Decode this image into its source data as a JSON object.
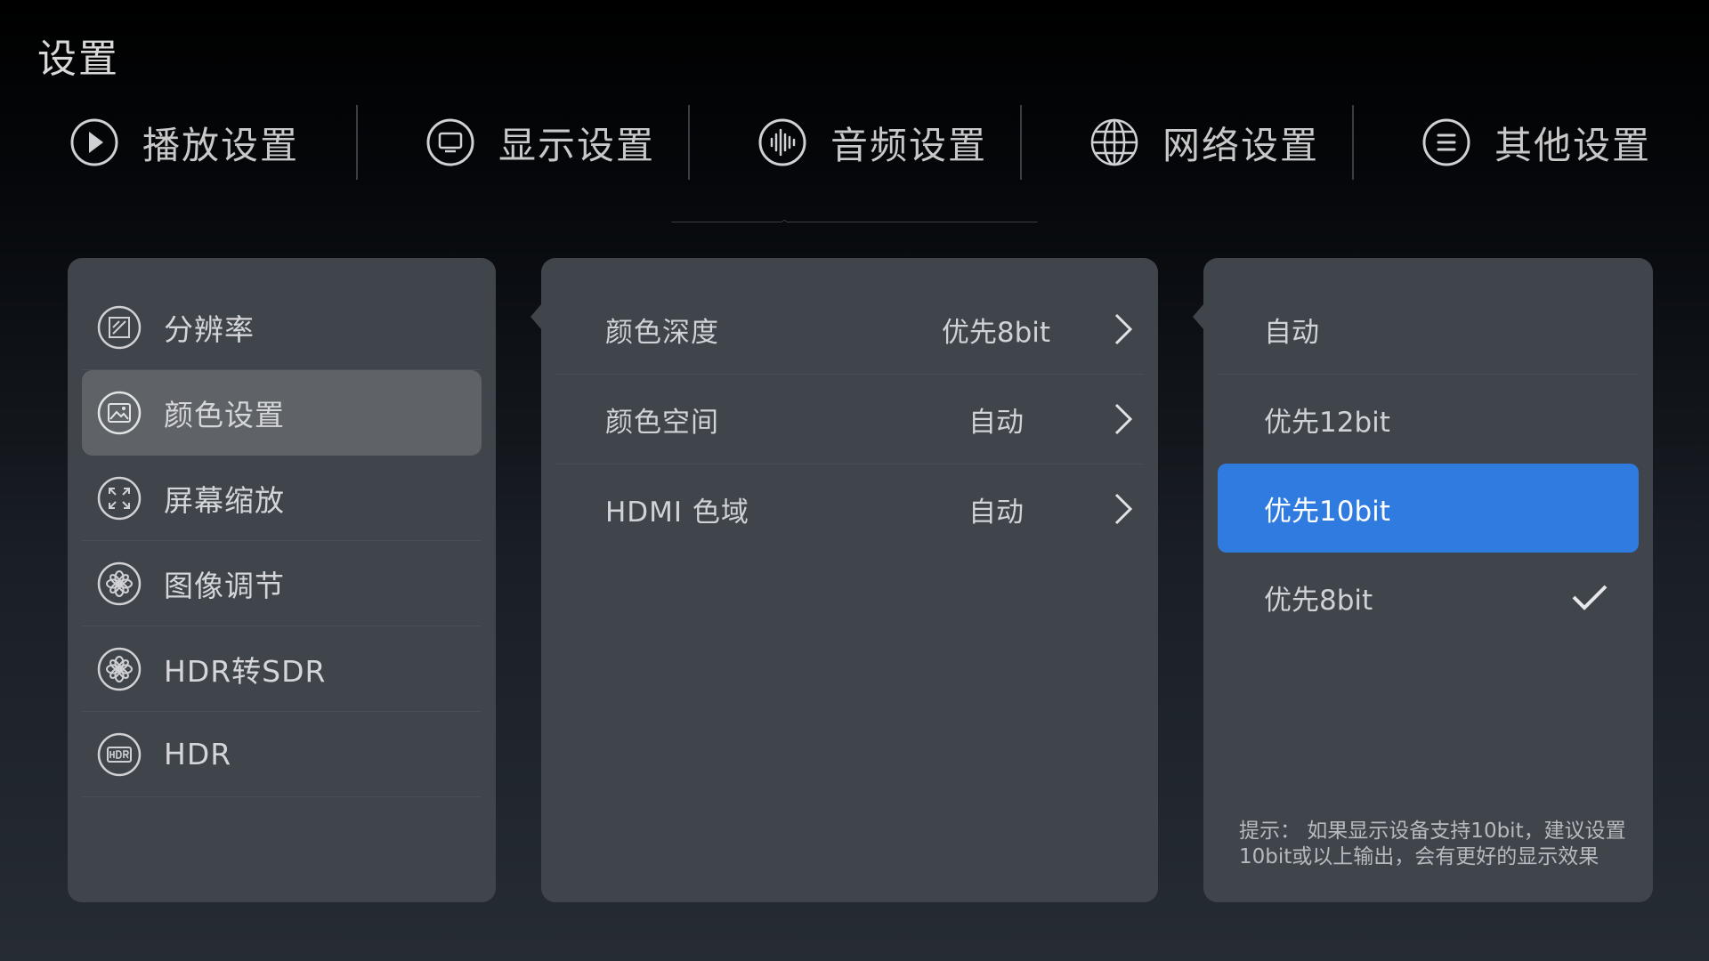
{
  "header": {
    "title": "设置"
  },
  "tabs": [
    {
      "label": "播放设置",
      "icon": "play-circle-icon"
    },
    {
      "label": "显示设置",
      "icon": "monitor-icon"
    },
    {
      "label": "音频设置",
      "icon": "audio-wave-icon"
    },
    {
      "label": "网络设置",
      "icon": "globe-icon"
    },
    {
      "label": "其他设置",
      "icon": "menu-icon"
    }
  ],
  "active_tab": "显示设置",
  "colors": {
    "background": "#000000",
    "panel": "#40444b",
    "selected_item": "#5f6368",
    "highlight": "#2f7be0",
    "text": "#d4d6d9"
  },
  "left_menu": {
    "items": [
      {
        "label": "分辨率",
        "icon": "resolution-icon"
      },
      {
        "label": "颜色设置",
        "icon": "image-icon"
      },
      {
        "label": "屏幕缩放",
        "icon": "expand-icon"
      },
      {
        "label": "图像调节",
        "icon": "aperture-icon"
      },
      {
        "label": "HDR转SDR",
        "icon": "aperture-icon"
      },
      {
        "label": "HDR",
        "icon": "hdr-icon"
      }
    ],
    "selected": "颜色设置"
  },
  "color_settings": {
    "rows": [
      {
        "label": "颜色深度",
        "value": "优先8bit"
      },
      {
        "label": "颜色空间",
        "value": "自动"
      },
      {
        "label": "HDMI 色域",
        "value": "自动"
      }
    ]
  },
  "options": {
    "items": [
      {
        "label": "自动"
      },
      {
        "label": "优先12bit"
      },
      {
        "label": "优先10bit"
      },
      {
        "label": "优先8bit"
      }
    ],
    "highlighted": "优先10bit",
    "checked": "优先8bit",
    "tip": "提示： 如果显示设备支持10bit，建议设置10bit或以上输出，会有更好的显示效果"
  }
}
